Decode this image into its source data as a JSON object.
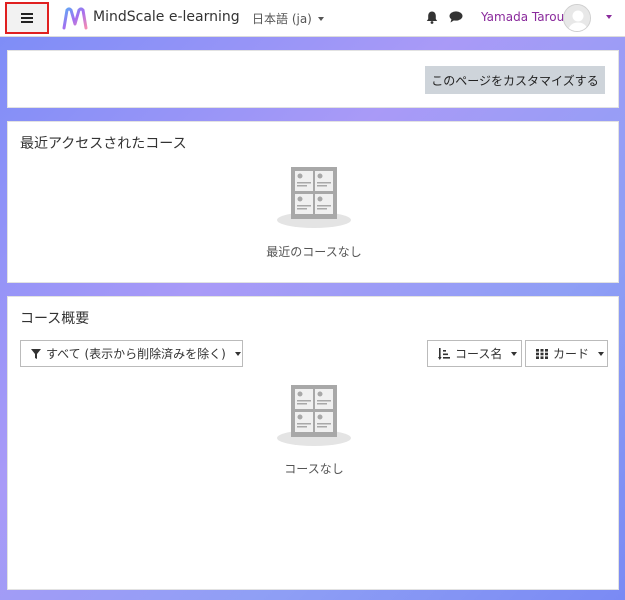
{
  "navbar": {
    "site_name": "MindScale e-learning",
    "language": "日本語 ‎(ja)‎",
    "username": "Yamada Tarou",
    "accent_color": "#8a2a9c"
  },
  "customize": {
    "button_label": "このページをカスタマイズする"
  },
  "recent_courses": {
    "title": "最近アクセスされたコース",
    "empty_text": "最近のコースなし"
  },
  "course_overview": {
    "title": "コース概要",
    "filter_label": "すべて (表示から削除済みを除く)",
    "sort_label": "コース名",
    "view_label": "カード",
    "empty_text": "コースなし"
  },
  "icons": {
    "menu": "hamburger-icon",
    "notifications": "bell-icon",
    "messages": "chat-icon",
    "filter": "funnel-icon",
    "sort": "sort-icon",
    "view": "grid-icon"
  }
}
